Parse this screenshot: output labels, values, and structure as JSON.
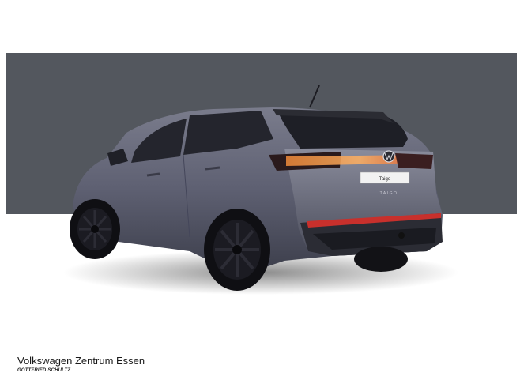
{
  "scene": {
    "backdrop_color": "#53575e",
    "floor_color": "#ffffff",
    "car_body_color": "#5e6072",
    "taillight_color": "#d3332f"
  },
  "car": {
    "model_plate": "Taigo",
    "tailgate_badge": "TAIGO",
    "brand_logo": "vw-logo-icon"
  },
  "dealer": {
    "name": "Volkswagen Zentrum Essen",
    "sub_brand": "GOTTFRIED SCHULTZ"
  }
}
